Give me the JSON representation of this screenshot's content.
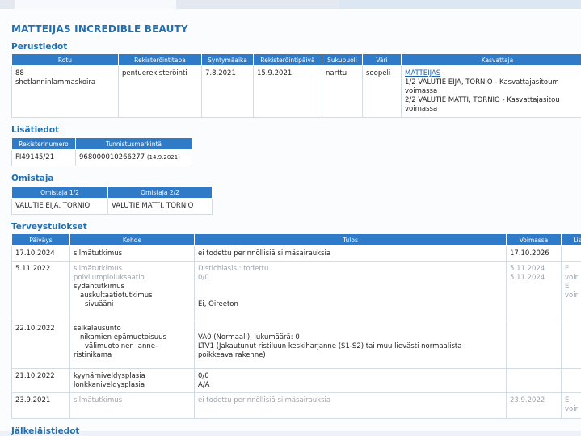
{
  "title": "MATTEIJAS INCREDIBLE BEAUTY",
  "perustiedot": {
    "heading": "Perustiedot",
    "headers": [
      "Rotu",
      "Rekisteröintitapa",
      "Syntymäaika",
      "Rekisteröintipäivä",
      "Sukupuoli",
      "Väri",
      "Kasvattaja"
    ],
    "rotu_lines": [
      "88",
      "shetlanninlammaskoira"
    ],
    "rekisterointitapa": "pentuerekisteröinti",
    "syntymaaika": "7.8.2021",
    "rekisterointipaiva": "15.9.2021",
    "sukupuoli": "narttu",
    "vari": "soopeli",
    "kasvattaja_link": "MATTEIJAS",
    "kasvattaja_lines": [
      "1/2 VALUTIE EIJA, TORNIO - Kasvattajasitoum",
      "voimassa",
      "2/2 VALUTIE MATTI, TORNIO - Kasvattajasitou",
      "voimassa"
    ]
  },
  "lisatiedot": {
    "heading": "Lisätiedot",
    "headers": [
      "Rekisterinumero",
      "Tunnistusmerkintä"
    ],
    "rekisterinumero": "FI49145/21",
    "tunnistus": "968000010266277",
    "tunnistus_date": "(14.9.2021)"
  },
  "omistaja": {
    "heading": "Omistaja",
    "headers": [
      "Omistaja 1/2",
      "Omistaja 2/2"
    ],
    "values": [
      "VALUTIE EIJA, TORNIO",
      "VALUTIE MATTI, TORNIO"
    ]
  },
  "terveys": {
    "heading": "Terveystulokset",
    "headers": [
      "Päiväys",
      "Kohde",
      "Tulos",
      "Voimassa",
      "Lis"
    ],
    "rows": [
      {
        "date": "17.10.2024",
        "kohde": [
          "silmätutkimus"
        ],
        "tulos": [
          "ei todettu perinnöllisiä silmäsairauksia"
        ],
        "voimassa": [
          "17.10.2026"
        ],
        "lisa": [
          ""
        ]
      },
      {
        "date": "5.11.2022",
        "kohde": [
          "silmätutkimus",
          "polvilumpioluksaatio",
          "sydäntutkimus",
          "auskultaatiotutkimus",
          "sivuääni"
        ],
        "tulos": [
          "Distichiasis : todettu",
          "0/0",
          "",
          "",
          "Ei, Oireeton"
        ],
        "voimassa": [
          "5.11.2024",
          "5.11.2024"
        ],
        "lisa": [
          "Ei",
          "voir",
          "Ei",
          "voir"
        ]
      },
      {
        "date": "22.10.2022",
        "kohde": [
          "selkälausunto",
          "nikamien epämuotoisuus",
          "välimuotoinen lanne-",
          "ristinikama"
        ],
        "tulos": [
          "VA0 (Normaali), lukumäärä: 0",
          "LTV1 (Jakautunut ristiluun keskiharjanne (S1-S2) tai muu lievästi normaalista",
          "poikkeava rakenne)"
        ],
        "voimassa": [],
        "lisa": []
      },
      {
        "date": "21.10.2022",
        "kohde": [
          "kyynärniveldysplasia",
          "lonkkaniveldysplasia"
        ],
        "tulos": [
          "0/0",
          "A/A"
        ],
        "voimassa": [],
        "lisa": []
      },
      {
        "date": "23.9.2021",
        "kohde": [
          "silmätutkimus"
        ],
        "tulos": [
          "ei todettu perinnöllisiä silmäsairauksia"
        ],
        "voimassa": [
          "23.9.2022"
        ],
        "lisa": [
          "Ei",
          "voir"
        ]
      }
    ]
  },
  "next_heading": "Jälkeläistiedot"
}
